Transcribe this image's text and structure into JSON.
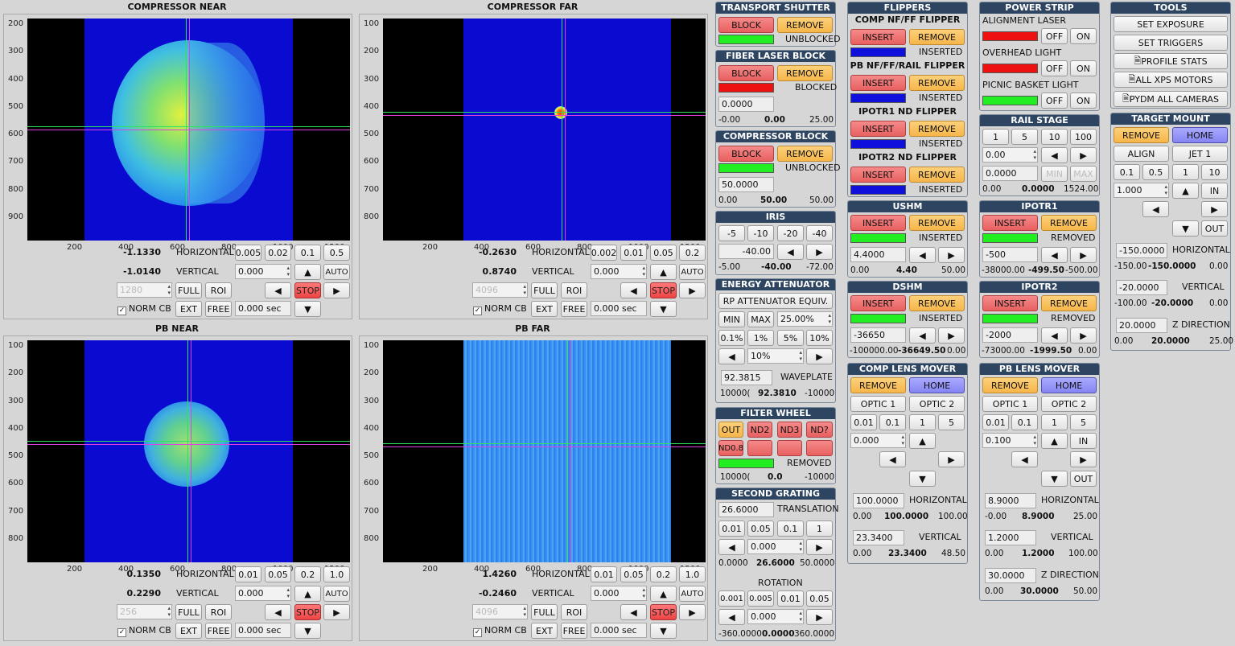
{
  "cameras": [
    {
      "title": "COMPRESSOR NEAR",
      "yticks": [
        "200",
        "300",
        "400",
        "500",
        "600",
        "700",
        "800",
        "900"
      ],
      "xticks": [
        "200",
        "400",
        "600",
        "800",
        "1000",
        "1200"
      ],
      "h_val": "-1.1330",
      "v_val": "-1.0140",
      "h_label": "HORIZONTAL",
      "v_label": "VERTICAL",
      "steps": [
        "0.005",
        "0.02",
        "0.1",
        "0.5"
      ],
      "step_field": "0.000",
      "auto": "AUTO",
      "bin": "1280",
      "full": "FULL",
      "roi": "ROI",
      "stop": "STOP",
      "norm": "NORM CB",
      "ext": "EXT",
      "free": "FREE",
      "exposure": "0.000 sec"
    },
    {
      "title": "COMPRESSOR FAR",
      "yticks": [
        "100",
        "200",
        "300",
        "400",
        "500",
        "600",
        "700",
        "800"
      ],
      "xticks": [
        "200",
        "400",
        "600",
        "800",
        "1000",
        "1200"
      ],
      "h_val": "-0.2630",
      "v_val": "0.8740",
      "h_label": "HORIZONTAL",
      "v_label": "VERTICAL",
      "steps": [
        "0.002",
        "0.01",
        "0.05",
        "0.2"
      ],
      "step_field": "0.000",
      "auto": "AUTO",
      "bin": "4096",
      "full": "FULL",
      "roi": "ROI",
      "stop": "STOP",
      "norm": "NORM CB",
      "ext": "EXT",
      "free": "FREE",
      "exposure": "0.000 sec"
    },
    {
      "title": "PB NEAR",
      "yticks": [
        "100",
        "200",
        "300",
        "400",
        "500",
        "600",
        "700",
        "800"
      ],
      "xticks": [
        "200",
        "400",
        "600",
        "800",
        "1000",
        "1200"
      ],
      "h_val": "0.1350",
      "v_val": "0.2290",
      "h_label": "HORIZONTAL",
      "v_label": "VERTICAL",
      "steps": [
        "0.01",
        "0.05",
        "0.2",
        "1.0"
      ],
      "step_field": "0.000",
      "auto": "AUTO",
      "bin": "256",
      "full": "FULL",
      "roi": "ROI",
      "stop": "STOP",
      "norm": "NORM CB",
      "ext": "EXT",
      "free": "FREE",
      "exposure": "0.000 sec"
    },
    {
      "title": "PB FAR",
      "yticks": [
        "100",
        "200",
        "300",
        "400",
        "500",
        "600",
        "700",
        "800"
      ],
      "xticks": [
        "200",
        "400",
        "600",
        "800",
        "1000",
        "1200"
      ],
      "h_val": "1.4260",
      "v_val": "-0.2460",
      "h_label": "HORIZONTAL",
      "v_label": "VERTICAL",
      "steps": [
        "0.01",
        "0.05",
        "0.2",
        "1.0"
      ],
      "step_field": "0.000",
      "auto": "AUTO",
      "bin": "4096",
      "full": "FULL",
      "roi": "ROI",
      "stop": "STOP",
      "norm": "NORM CB",
      "ext": "EXT",
      "free": "FREE",
      "exposure": "0.000 sec"
    }
  ],
  "col1": {
    "transport": {
      "title": "TRANSPORT SHUTTER",
      "block": "BLOCK",
      "remove": "REMOVE",
      "status": "UNBLOCKED"
    },
    "fiber": {
      "title": "FIBER LASER BLOCK",
      "block": "BLOCK",
      "remove": "REMOVE",
      "status": "BLOCKED",
      "field": "0.0000",
      "min": "-0.00",
      "cur": "0.00",
      "max": "25.00"
    },
    "compblock": {
      "title": "COMPRESSOR BLOCK",
      "block": "BLOCK",
      "remove": "REMOVE",
      "status": "UNBLOCKED",
      "field": "50.0000",
      "min": "0.00",
      "cur": "50.00",
      "max": "50.00"
    },
    "iris": {
      "title": "IRIS",
      "b1": "-5",
      "b2": "-10",
      "b3": "-20",
      "b4": "-40",
      "field": "-40.00",
      "min": "-5.00",
      "cur": "-40.00",
      "max": "-72.00"
    },
    "energy": {
      "title": "ENERGY ATTENUATOR",
      "equiv": "RP ATTENUATOR  EQUIV.",
      "min": "MIN",
      "max": "MAX",
      "pct": "25.00%",
      "p1": "0.1%",
      "p2": "1%",
      "p3": "5%",
      "p4": "10%",
      "step": "10%",
      "field": "92.3815",
      "wave": "WAVEPLATE",
      "lo": "10000(",
      "cur": "92.3810",
      "hi": "-10000"
    },
    "filter": {
      "title": "FILTER WHEEL",
      "out": "OUT",
      "nd2": "ND2",
      "nd3": "ND3",
      "nd4": "ND?",
      "nd08": "ND0.8",
      "status": "REMOVED",
      "lo": "10000(",
      "cur": "0.0",
      "hi": "-10000"
    },
    "grating": {
      "title": "SECOND GRATING",
      "tfield": "26.6000",
      "tlabel": "TRANSLATION",
      "s1": "0.01",
      "s2": "0.05",
      "s3": "0.1",
      "s4": "1",
      "tstep": "0.000",
      "tmin": "0.0000",
      "tcur": "26.6000",
      "tmax": "50.0000",
      "rot": "ROTATION",
      "r1": "0.001",
      "r2": "0.005",
      "r3": "0.01",
      "r4": "0.05",
      "rstep": "0.000",
      "rmin": "-360.0000",
      "rcur": "0.0000",
      "rmax": "360.0000"
    }
  },
  "col2": {
    "flippers": {
      "title": "FLIPPERS",
      "items": [
        {
          "name": "COMP NF/FF FLIPPER",
          "status": "INSERTED"
        },
        {
          "name": "PB NF/FF/RAIL FLIPPER",
          "status": "INSERTED"
        },
        {
          "name": "IPOTR1 ND FLIPPER",
          "status": "INSERTED"
        },
        {
          "name": "IPOTR2 ND FLIPPER",
          "status": "INSERTED"
        }
      ],
      "insert": "INSERT",
      "remove": "REMOVE"
    },
    "ushm": {
      "title": "USHM",
      "insert": "INSERT",
      "remove": "REMOVE",
      "status": "INSERTED",
      "field": "4.4000",
      "min": "0.00",
      "cur": "4.40",
      "max": "50.00"
    },
    "dshm": {
      "title": "DSHM",
      "insert": "INSERT",
      "remove": "REMOVE",
      "status": "INSERTED",
      "field": "-36650",
      "min": "-100000.00",
      "cur": "-36649.50",
      "max": "0.00"
    },
    "complens": {
      "title": "COMP LENS MOVER",
      "remove": "REMOVE",
      "home": "HOME",
      "o1": "OPTIC 1",
      "o2": "OPTIC 2",
      "s1": "0.01",
      "s2": "0.1",
      "s3": "1",
      "s4": "5",
      "step": "0.000",
      "hfield": "100.0000",
      "hlabel": "HORIZONTAL",
      "hmin": "0.00",
      "hcur": "100.0000",
      "hmax": "100.00",
      "vfield": "23.3400",
      "vlabel": "VERTICAL",
      "vmin": "0.00",
      "vcur": "23.3400",
      "vmax": "48.50"
    }
  },
  "col3": {
    "power": {
      "title": "POWER STRIP",
      "items": [
        {
          "name": "ALIGNMENT LASER"
        },
        {
          "name": "OVERHEAD LIGHT"
        },
        {
          "name": "PICNIC BASKET LIGHT"
        }
      ],
      "off": "OFF",
      "on": "ON"
    },
    "rail": {
      "title": "RAIL STAGE",
      "s1": "1",
      "s2": "5",
      "s3": "10",
      "s4": "100",
      "step": "0.00",
      "field": "0.0000",
      "minb": "MIN",
      "maxb": "MAX",
      "min": "0.00",
      "cur": "0.0000",
      "max": "1524.00"
    },
    "ipotr1": {
      "title": "IPOTR1",
      "insert": "INSERT",
      "remove": "REMOVE",
      "status": "REMOVED",
      "field": "-500",
      "min": "-38000.00",
      "cur": "-499.50",
      "max": "-500.00"
    },
    "ipotr2": {
      "title": "IPOTR2",
      "insert": "INSERT",
      "remove": "REMOVE",
      "status": "REMOVED",
      "field": "-2000",
      "min": "-73000.00",
      "cur": "-1999.50",
      "max": "0.00"
    },
    "pblens": {
      "title": "PB LENS MOVER",
      "remove": "REMOVE",
      "home": "HOME",
      "o1": "OPTIC 1",
      "o2": "OPTIC 2",
      "s1": "0.01",
      "s2": "0.1",
      "s3": "1",
      "s4": "5",
      "step": "0.100",
      "in": "IN",
      "out": "OUT",
      "hfield": "8.9000",
      "hlabel": "HORIZONTAL",
      "hmin": "-0.00",
      "hcur": "8.9000",
      "hmax": "25.00",
      "vfield": "1.2000",
      "vlabel": "VERTICAL",
      "vmin": "0.00",
      "vcur": "1.2000",
      "vmax": "100.00",
      "zfield": "30.0000",
      "zlabel": "Z DIRECTION",
      "zmin": "0.00",
      "zcur": "30.0000",
      "zmax": "50.00"
    }
  },
  "col4": {
    "tools": {
      "title": "TOOLS",
      "b1": "SET EXPOSURE",
      "b2": "SET TRIGGERS",
      "b3": "PROFILE STATS",
      "b4": "ALL XPS MOTORS",
      "b5": "PYDM ALL CAMERAS"
    },
    "target": {
      "title": "TARGET MOUNT",
      "remove": "REMOVE",
      "home": "HOME",
      "align": "ALIGN",
      "jet": "JET 1",
      "s1": "0.1",
      "s2": "0.5",
      "s3": "1",
      "s4": "10",
      "step": "1.000",
      "in": "IN",
      "out": "OUT",
      "hfield": "-150.0000",
      "hlabel": "HORIZONTAL",
      "hmin": "-150.00",
      "hcur": "-150.0000",
      "hmax": "0.00",
      "vfield": "-20.0000",
      "vlabel": "VERTICAL",
      "vmin": "-100.00",
      "vcur": "-20.0000",
      "vmax": "0.00",
      "zfield": "20.0000",
      "zlabel": "Z DIRECTION",
      "zmin": "0.00",
      "zcur": "20.0000",
      "zmax": "25.00"
    }
  },
  "colors": {
    "header": "#2e4562",
    "green": "#22ee22",
    "red": "#ee1111",
    "blue": "#1010dd",
    "plot_bg": "#0a0ad0"
  }
}
